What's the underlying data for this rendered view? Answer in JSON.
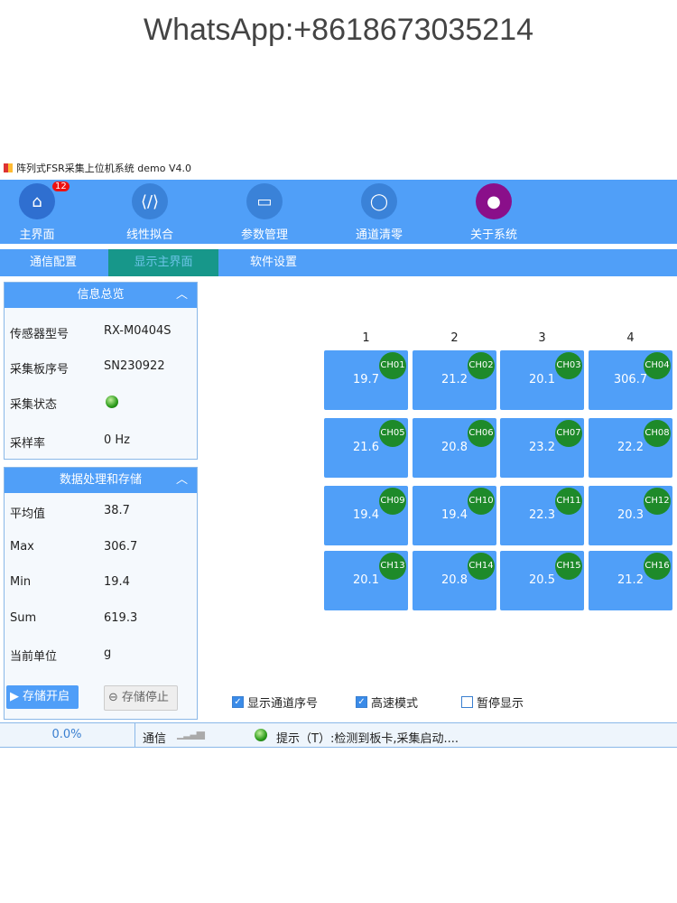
{
  "watermark": "WhatsApp:+8618673035214",
  "window_title": "阵列式FSR采集上位机系统 demo V4.0",
  "nav": [
    {
      "label": "主界面",
      "icon": "home-icon",
      "badge": "12"
    },
    {
      "label": "线性拟合",
      "icon": "code-file-icon"
    },
    {
      "label": "参数管理",
      "icon": "drive-icon"
    },
    {
      "label": "通道清零",
      "icon": "circle-refresh-icon"
    },
    {
      "label": "关于系统",
      "icon": "user-icon"
    }
  ],
  "tabs": [
    "通信配置",
    "显示主界面",
    "软件设置"
  ],
  "info": {
    "title": "信息总览",
    "rows": [
      {
        "label": "传感器型号",
        "value": "RX-M0404S"
      },
      {
        "label": "采集板序号",
        "value": "SN230922"
      },
      {
        "label": "采集状态",
        "value": null
      },
      {
        "label": "采样率",
        "value": "0 Hz"
      }
    ]
  },
  "stats": {
    "title": "数据处理和存储",
    "rows": [
      {
        "label": "平均值",
        "value": "38.7"
      },
      {
        "label": "Max",
        "value": "306.7"
      },
      {
        "label": "Min",
        "value": "19.4"
      },
      {
        "label": "Sum",
        "value": "619.3"
      },
      {
        "label": "当前单位",
        "value": "g"
      }
    ],
    "start": "存储开启",
    "stop": "存储停止"
  },
  "columns": [
    "1",
    "2",
    "3",
    "4"
  ],
  "channels": [
    {
      "ch": "CH01",
      "v": "19.7"
    },
    {
      "ch": "CH02",
      "v": "21.2"
    },
    {
      "ch": "CH03",
      "v": "20.1"
    },
    {
      "ch": "CH04",
      "v": "306.7"
    },
    {
      "ch": "CH05",
      "v": "21.6"
    },
    {
      "ch": "CH06",
      "v": "20.8"
    },
    {
      "ch": "CH07",
      "v": "23.2"
    },
    {
      "ch": "CH08",
      "v": "22.2"
    },
    {
      "ch": "CH09",
      "v": "19.4"
    },
    {
      "ch": "CH10",
      "v": "19.4"
    },
    {
      "ch": "CH11",
      "v": "22.3"
    },
    {
      "ch": "CH12",
      "v": "20.3"
    },
    {
      "ch": "CH13",
      "v": "20.1"
    },
    {
      "ch": "CH14",
      "v": "20.8"
    },
    {
      "ch": "CH15",
      "v": "20.5"
    },
    {
      "ch": "CH16",
      "v": "21.2"
    }
  ],
  "options": [
    {
      "label": "显示通道序号",
      "checked": true
    },
    {
      "label": "高速模式",
      "checked": true
    },
    {
      "label": "暂停显示",
      "checked": false
    }
  ],
  "status": {
    "progress": "0.0%",
    "comm": "通信",
    "message": "提示（T）:检测到板卡,采集启动...."
  }
}
